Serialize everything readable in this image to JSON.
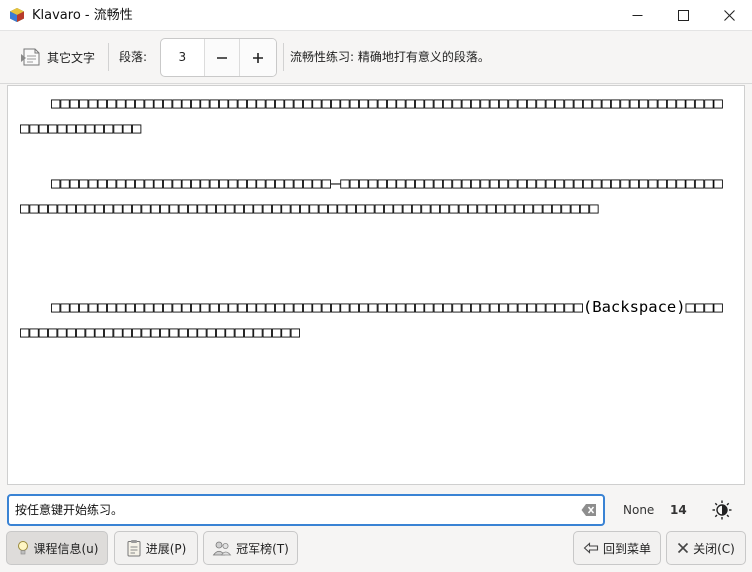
{
  "window": {
    "title": "Klavaro - 流畅性"
  },
  "toolbar": {
    "other_text_label": "其它文字",
    "paragraphs_label": "段落:",
    "paragraphs_value": "3",
    "hint": "流畅性练习: 精确地打有意义的段落。"
  },
  "text_area": {
    "paragraphs": [
      "　　□□□□□□□□□□□□□□□□□□□□□□□□□□□□□□□□□□□□□□□□□□□□□□□□□□□□□□□□□□□□□□□□□□□□□□□□□□□□□□□□□□□□□",
      "　　□□□□□□□□□□□□□□□□□□□□□□□□□□□□□□—□□□□□□□□□□□□□□□□□□□□□□□□□□□□□□□□□□□□□□□□□□□□□□□□□□□□□□□□□□□□□□□□□□□□□□□□□□□□□□□□□□□□□□□□□□□□□□□□□□□□□□□",
      "　　□□□□□□□□□□□□□□□□□□□□□□□□□□□□□□□□□□□□□□□□□□□□□□□□□□□□□□□□□(Backspace)□□□□□□□□□□□□□□□□□□□□□□□□□□□□□□□□□□"
    ]
  },
  "status": {
    "input_text": "按任意键开始练习。",
    "speed": "None",
    "accuracy": "14"
  },
  "buttons": {
    "course_info": "课程信息(u)",
    "progress": "进展(P)",
    "champions": "冠军榜(T)",
    "back_to_menu": "回到菜单",
    "close": "关闭(C)"
  }
}
